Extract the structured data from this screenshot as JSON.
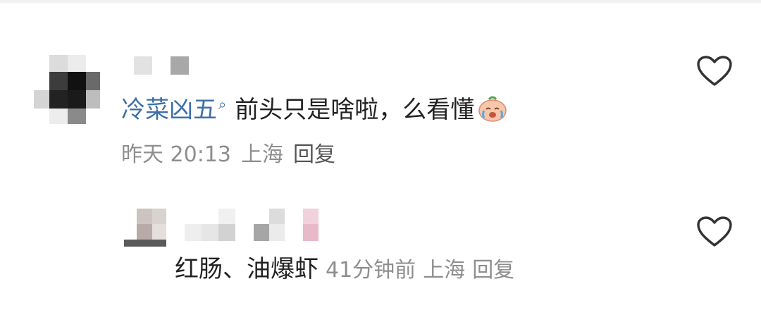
{
  "comments": [
    {
      "mention": "冷菜凶五",
      "mention_icon": "search-icon",
      "text": "前头只是啥啦，么看懂",
      "emoji": "crying-face-emoji",
      "time": "昨天 20:13",
      "location": "上海",
      "reply_label": "回复",
      "like_icon": "heart-icon"
    },
    {
      "text": "红肠、油爆虾",
      "time": "41分钟前",
      "location": "上海",
      "reply_label": "回复",
      "like_icon": "heart-icon"
    }
  ],
  "colors": {
    "mention": "#3d6fa8",
    "meta": "#8e8e8e",
    "text": "#222222"
  }
}
